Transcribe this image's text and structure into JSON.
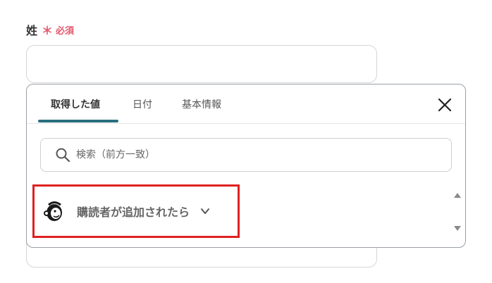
{
  "field": {
    "label": "姓",
    "required_star": "＊",
    "required_text": "必須"
  },
  "popup": {
    "tabs": [
      {
        "label": "取得した値",
        "active": true
      },
      {
        "label": "日付",
        "active": false
      },
      {
        "label": "基本情報",
        "active": false
      }
    ],
    "search_placeholder": "検索（前方一致）",
    "source_item": {
      "label": "購読者が追加されたら",
      "icon": "mailchimp-logo"
    }
  },
  "colors": {
    "accent": "#2a6f7f",
    "required": "#e05a6d",
    "highlight_border": "#e02020"
  }
}
